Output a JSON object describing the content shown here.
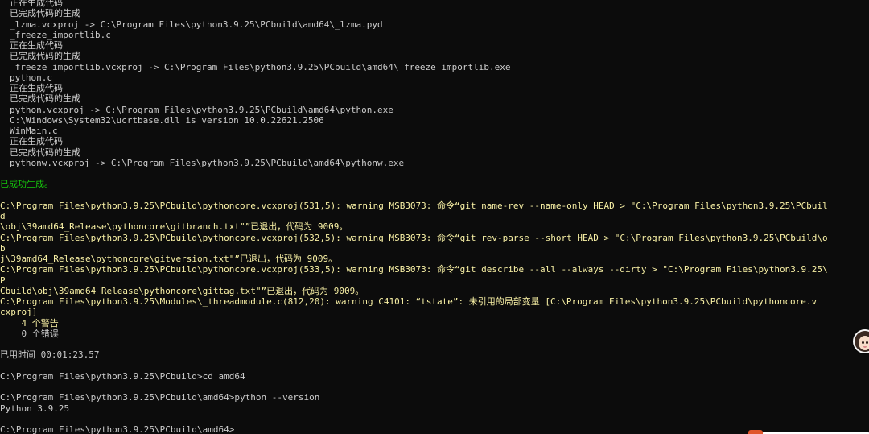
{
  "terminal": {
    "colors": {
      "background": "#0c0c0c",
      "default": "#cccccc",
      "success": "#16c60c",
      "warning": "#f9f1a5",
      "accent": "#e0552a"
    },
    "lines": [
      {
        "indent": 12,
        "style": "default",
        "text": "正在生成代码"
      },
      {
        "indent": 12,
        "style": "default",
        "text": "已完成代码的生成"
      },
      {
        "indent": 12,
        "style": "default",
        "text": "_lzma.vcxproj -> C:\\Program Files\\python3.9.25\\PCbuild\\amd64\\_lzma.pyd"
      },
      {
        "indent": 12,
        "style": "default",
        "text": "_freeze_importlib.c"
      },
      {
        "indent": 12,
        "style": "default",
        "text": "正在生成代码"
      },
      {
        "indent": 12,
        "style": "default",
        "text": "已完成代码的生成"
      },
      {
        "indent": 12,
        "style": "default",
        "text": "_freeze_importlib.vcxproj -> C:\\Program Files\\python3.9.25\\PCbuild\\amd64\\_freeze_importlib.exe"
      },
      {
        "indent": 12,
        "style": "default",
        "text": "python.c"
      },
      {
        "indent": 12,
        "style": "default",
        "text": "正在生成代码"
      },
      {
        "indent": 12,
        "style": "default",
        "text": "已完成代码的生成"
      },
      {
        "indent": 12,
        "style": "default",
        "text": "python.vcxproj -> C:\\Program Files\\python3.9.25\\PCbuild\\amd64\\python.exe"
      },
      {
        "indent": 12,
        "style": "default",
        "text": "C:\\Windows\\System32\\ucrtbase.dll is version 10.0.22621.2506"
      },
      {
        "indent": 12,
        "style": "default",
        "text": "WinMain.c"
      },
      {
        "indent": 12,
        "style": "default",
        "text": "正在生成代码"
      },
      {
        "indent": 12,
        "style": "default",
        "text": "已完成代码的生成"
      },
      {
        "indent": 12,
        "style": "default",
        "text": "pythonw.vcxproj -> C:\\Program Files\\python3.9.25\\PCbuild\\amd64\\pythonw.exe"
      },
      {
        "indent": 0,
        "style": "default",
        "text": ""
      },
      {
        "indent": 0,
        "style": "success",
        "text": "已成功生成。"
      },
      {
        "indent": 0,
        "style": "default",
        "text": ""
      },
      {
        "indent": 0,
        "style": "warning",
        "text": "C:\\Program Files\\python3.9.25\\PCbuild\\pythoncore.vcxproj(531,5): warning MSB3073: 命令“git name-rev --name-only HEAD > \"C:\\Program Files\\python3.9.25\\PCbuil"
      },
      {
        "indent": 0,
        "style": "warning",
        "text": "d"
      },
      {
        "indent": 0,
        "style": "warning",
        "text": "\\obj\\39amd64_Release\\pythoncore\\gitbranch.txt\"”已退出，代码为 9009。"
      },
      {
        "indent": 0,
        "style": "warning",
        "text": "C:\\Program Files\\python3.9.25\\PCbuild\\pythoncore.vcxproj(532,5): warning MSB3073: 命令“git rev-parse --short HEAD > \"C:\\Program Files\\python3.9.25\\PCbuild\\o"
      },
      {
        "indent": 0,
        "style": "warning",
        "text": "b"
      },
      {
        "indent": 0,
        "style": "warning",
        "text": "j\\39amd64_Release\\pythoncore\\gitversion.txt\"”已退出，代码为 9009。"
      },
      {
        "indent": 0,
        "style": "warning",
        "text": "C:\\Program Files\\python3.9.25\\PCbuild\\pythoncore.vcxproj(533,5): warning MSB3073: 命令“git describe --all --always --dirty > \"C:\\Program Files\\python3.9.25\\"
      },
      {
        "indent": 0,
        "style": "warning",
        "text": "P"
      },
      {
        "indent": 0,
        "style": "warning",
        "text": "Cbuild\\obj\\39amd64_Release\\pythoncore\\gittag.txt\"”已退出，代码为 9009。"
      },
      {
        "indent": 0,
        "style": "warning",
        "text": "C:\\Program Files\\python3.9.25\\Modules\\_threadmodule.c(812,20): warning C4101: “tstate”: 未引用的局部变量 [C:\\Program Files\\python3.9.25\\PCbuild\\pythoncore.v"
      },
      {
        "indent": 0,
        "style": "warning",
        "text": "cxproj]"
      },
      {
        "indent": 0,
        "style": "warning",
        "text": "    4 个警告"
      },
      {
        "indent": 0,
        "style": "default",
        "text": "    0 个错误"
      },
      {
        "indent": 0,
        "style": "default",
        "text": ""
      },
      {
        "indent": 0,
        "style": "default",
        "text": "已用时间 00:01:23.57"
      },
      {
        "indent": 0,
        "style": "default",
        "text": ""
      },
      {
        "indent": 0,
        "style": "default",
        "text": "C:\\Program Files\\python3.9.25\\PCbuild>cd amd64"
      },
      {
        "indent": 0,
        "style": "default",
        "text": ""
      },
      {
        "indent": 0,
        "style": "default",
        "text": "C:\\Program Files\\python3.9.25\\PCbuild\\amd64>python --version"
      },
      {
        "indent": 0,
        "style": "default",
        "text": "Python 3.9.25"
      },
      {
        "indent": 0,
        "style": "default",
        "text": ""
      },
      {
        "indent": 0,
        "style": "default",
        "text": "C:\\Program Files\\python3.9.25\\PCbuild\\amd64>"
      }
    ]
  },
  "overlay": {
    "avatar_icon": "avatar-icon"
  }
}
